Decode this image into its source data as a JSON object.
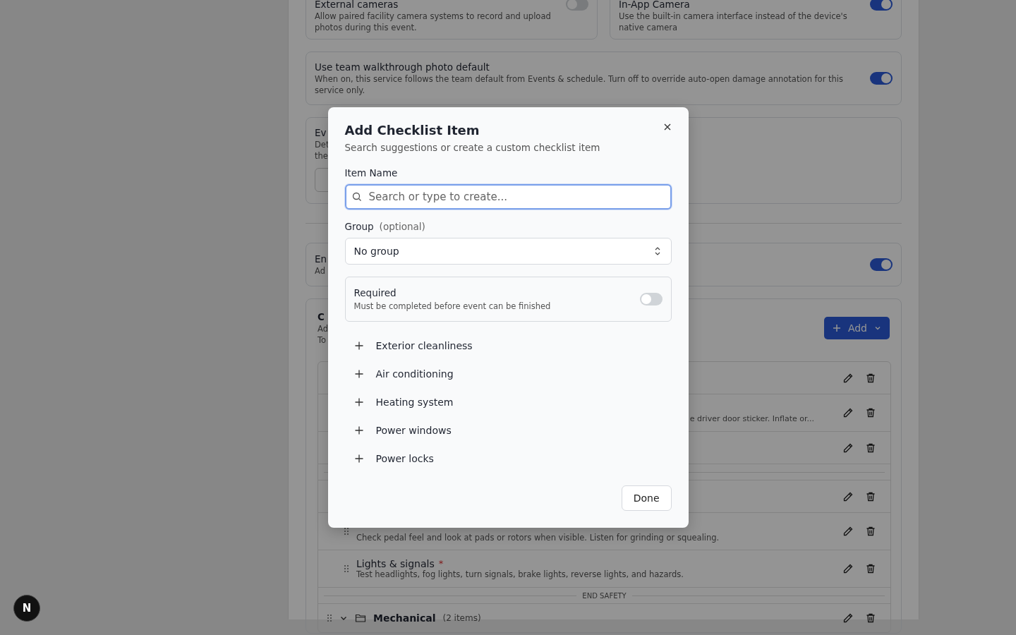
{
  "background": {
    "camera_cards": [
      {
        "title": "External cameras",
        "description": "Allow paired facility camera systems to record and upload photos during this event.",
        "on": false
      },
      {
        "title": "In-App Camera",
        "description": "Use the built-in camera interface instead of the device's native camera",
        "on": true
      }
    ],
    "walkthrough": {
      "title": "Use team walkthrough photo default",
      "description": "When on, this service follows the team default from Events & schedule. Turn off to override auto-open damage annotation for this service only.",
      "on": true
    },
    "event_card": {
      "title": "Ev",
      "lines": [
        "Det",
        "the"
      ]
    },
    "enable_card": {
      "title": "En",
      "description": "Ad",
      "on": true
    },
    "checklist": {
      "title": "C",
      "lines": [
        "Ad",
        "To"
      ],
      "add_button": "Add",
      "rows": [
        {
          "kind": "item"
        },
        {
          "kind": "fragment",
          "description": "e driver door sticker. Inflate or..."
        },
        {
          "kind": "item"
        },
        {
          "kind": "divider"
        },
        {
          "kind": "item"
        },
        {
          "kind": "fragment_low",
          "description": "Check pedal feel and look at pads or rotors when visible. Listen for grinding or squealing."
        },
        {
          "kind": "item",
          "title": "Lights & signals",
          "required_mark": "*",
          "description": "Test headlights, fog lights, turn signals, brake lights, reverse lights, and hazards."
        },
        {
          "kind": "divider",
          "label": "END SAFETY"
        },
        {
          "kind": "group",
          "title": "Mechanical",
          "count": "(2 items)",
          "expanded": true
        }
      ]
    }
  },
  "launcher": {
    "label": "N"
  },
  "dialog": {
    "title": "Add Checklist Item",
    "subtitle": "Search suggestions or create a custom checklist item",
    "name_label": "Item Name",
    "search_placeholder": "Search or type to create...",
    "group_label": "Group",
    "group_hint": "(optional)",
    "group_value": "No group",
    "required": {
      "title": "Required",
      "description": "Must be completed before event can be finished",
      "on": false
    },
    "suggestions": [
      "Exterior cleanliness",
      "Air conditioning",
      "Heating system",
      "Power windows",
      "Power locks"
    ],
    "done": "Done"
  }
}
